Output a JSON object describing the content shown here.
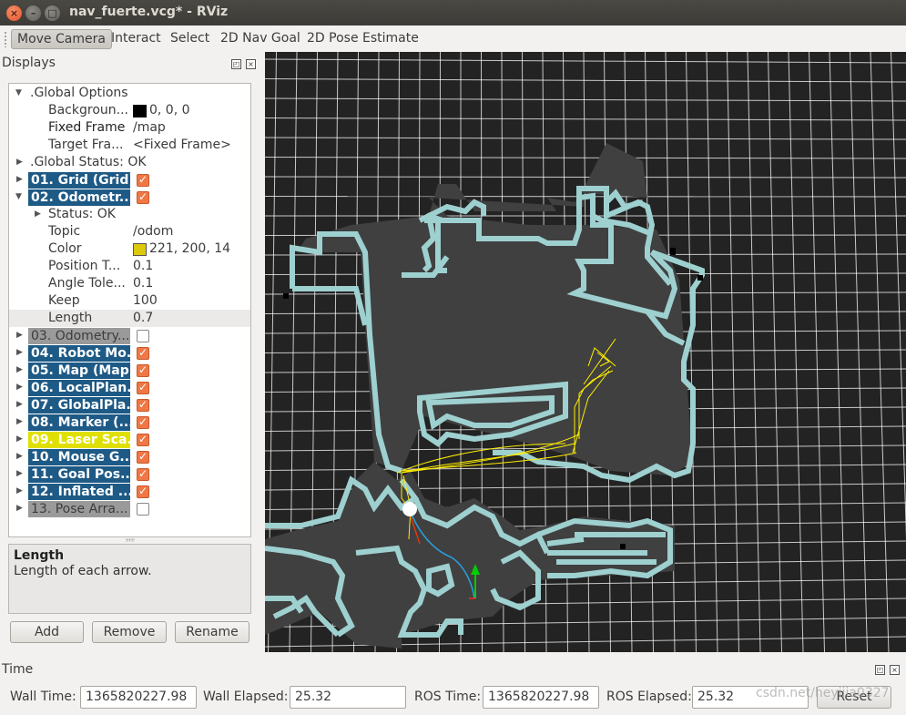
{
  "window": {
    "title": "nav_fuerte.vcg* - RViz"
  },
  "toolbar": {
    "tools": [
      "Move Camera",
      "Interact",
      "Select",
      "2D Nav Goal",
      "2D Pose Estimate"
    ],
    "active": "Move Camera"
  },
  "displays": {
    "title": "Displays",
    "global_options": {
      "label": ".Global Options",
      "background_label": "Backgroun...",
      "background_value": "0, 0, 0",
      "background_color": "#000000",
      "fixed_frame_label": "Fixed Frame",
      "fixed_frame_value": "/map",
      "target_frame_label": "Target Fra...",
      "target_frame_value": "<Fixed Frame>"
    },
    "global_status": ".Global Status: OK",
    "items": [
      {
        "label": "01. Grid (Grid)",
        "enabled": true,
        "style": "blue"
      },
      {
        "label": "02. Odometr...",
        "enabled": true,
        "style": "blue"
      },
      {
        "label": "03. Odometry...",
        "enabled": false,
        "style": "gray"
      },
      {
        "label": "04. Robot Mo...",
        "enabled": true,
        "style": "blue"
      },
      {
        "label": "05. Map (Map)",
        "enabled": true,
        "style": "blue"
      },
      {
        "label": "06. LocalPlan...",
        "enabled": true,
        "style": "blue"
      },
      {
        "label": "07. GlobalPla...",
        "enabled": true,
        "style": "blue"
      },
      {
        "label": "08. Marker (...",
        "enabled": true,
        "style": "blue"
      },
      {
        "label": "09. Laser Sca...",
        "enabled": true,
        "style": "yellow"
      },
      {
        "label": "10. Mouse G...",
        "enabled": true,
        "style": "blue"
      },
      {
        "label": "11. Goal Pos...",
        "enabled": true,
        "style": "blue"
      },
      {
        "label": "12. Inflated ...",
        "enabled": true,
        "style": "blue"
      },
      {
        "label": "13. Pose Arra...",
        "enabled": false,
        "style": "gray"
      }
    ],
    "odometry": {
      "status": "Status: OK",
      "topic_label": "Topic",
      "topic_value": "/odom",
      "color_label": "Color",
      "color_value": "221, 200, 14",
      "color_hex": "#ddc80e",
      "position_label": "Position T...",
      "position_value": "0.1",
      "angle_label": "Angle Tole...",
      "angle_value": "0.1",
      "keep_label": "Keep",
      "keep_value": "100",
      "length_label": "Length",
      "length_value": "0.7"
    },
    "description": {
      "title": "Length",
      "text": "Length of each arrow."
    },
    "buttons": {
      "add": "Add",
      "remove": "Remove",
      "rename": "Rename"
    }
  },
  "time": {
    "title": "Time",
    "wall_time_label": "Wall Time:",
    "wall_time": "1365820227.98",
    "wall_elapsed_label": "Wall Elapsed:",
    "wall_elapsed": "25.32",
    "ros_time_label": "ROS Time:",
    "ros_time": "1365820227.98",
    "ros_elapsed_label": "ROS Elapsed:",
    "ros_elapsed": "25.32",
    "reset_label": "Reset",
    "watermark": "csdn.net/heyijia0327"
  },
  "colors": {
    "grid": "#ffffff",
    "map_wall": "#9ed0d0",
    "map_free": "#404040",
    "path": "#ffee00"
  }
}
